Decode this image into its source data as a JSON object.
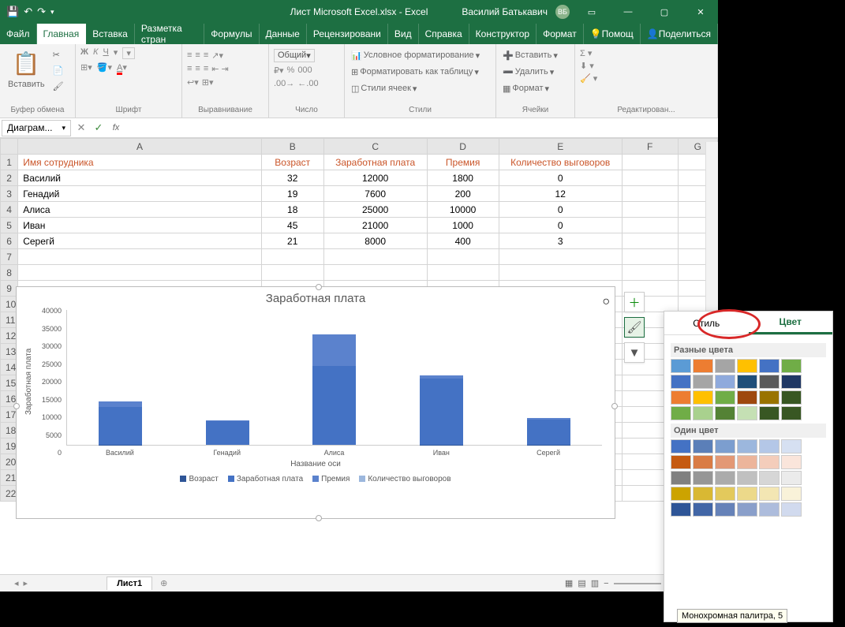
{
  "title": "Лист Microsoft Excel.xlsx  -  Excel",
  "user": "Василий Батькавич",
  "user_badge": "ВБ",
  "tabs": [
    "Файл",
    "Главная",
    "Вставка",
    "Разметка стран",
    "Формулы",
    "Данные",
    "Рецензировани",
    "Вид",
    "Справка",
    "Конструктор",
    "Формат"
  ],
  "help": "Помощ",
  "share": "Поделиться",
  "ribbon": {
    "clipboard": {
      "label": "Буфер обмена",
      "paste": "Вставить"
    },
    "font": {
      "label": "Шрифт"
    },
    "align": {
      "label": "Выравнивание"
    },
    "number": {
      "label": "Число",
      "format": "Общий"
    },
    "styles": {
      "label": "Стили",
      "cond": "Условное форматирование",
      "table": "Форматировать как таблицу",
      "cells": "Стили ячеек"
    },
    "cells_grp": {
      "label": "Ячейки",
      "insert": "Вставить",
      "delete": "Удалить",
      "format": "Формат"
    },
    "edit": {
      "label": "Редактирован..."
    }
  },
  "name_box": "Диаграм...",
  "headers": [
    "",
    "A",
    "B",
    "C",
    "D",
    "E",
    "F",
    "G"
  ],
  "column_headers": {
    "name": "Имя сотрудника",
    "age": "Возраст",
    "salary": "Заработная плата",
    "bonus": "Премия",
    "reprimands": "Количество выговоров"
  },
  "rows": [
    {
      "name": "Василий",
      "age": 32,
      "salary": 12000,
      "bonus": 1800,
      "rep": 0
    },
    {
      "name": "Генадий",
      "age": 19,
      "salary": 7600,
      "bonus": 200,
      "rep": 12
    },
    {
      "name": "Алиса",
      "age": 18,
      "salary": 25000,
      "bonus": 10000,
      "rep": 0
    },
    {
      "name": "Иван",
      "age": 45,
      "salary": 21000,
      "bonus": 1000,
      "rep": 0
    },
    {
      "name": "Серегй",
      "age": 21,
      "salary": 8000,
      "bonus": 400,
      "rep": 3
    }
  ],
  "chart_data": {
    "type": "bar",
    "title": "Заработная плата",
    "categories": [
      "Василий",
      "Генадий",
      "Алиса",
      "Иван",
      "Серегй"
    ],
    "series": [
      {
        "name": "Возраст",
        "values": [
          32,
          19,
          18,
          45,
          21
        ]
      },
      {
        "name": "Заработная плата",
        "values": [
          12000,
          7600,
          25000,
          21000,
          8000
        ]
      },
      {
        "name": "Премия",
        "values": [
          1800,
          200,
          10000,
          1000,
          400
        ]
      },
      {
        "name": "Количество выговоров",
        "values": [
          0,
          12,
          0,
          0,
          3
        ]
      }
    ],
    "ylim": [
      0,
      40000
    ],
    "ystep": 5000,
    "xlabel": "Название оси",
    "ylabel": "Заработная плата"
  },
  "sheet_tab": "Лист1",
  "color_panel": {
    "style": "Стиль",
    "color": "Цвет",
    "different": "Разные цвета",
    "single": "Один цвет",
    "tooltip": "Монохромная палитра, 5"
  },
  "palettes_diff": [
    [
      "#5b9bd5",
      "#ed7d31",
      "#a5a5a5",
      "#ffc000",
      "#4472c4",
      "#70ad47"
    ],
    [
      "#4472c4",
      "#a5a5a5",
      "#8faadc",
      "#1f4e79",
      "#595959",
      "#203864"
    ],
    [
      "#ed7d31",
      "#ffc000",
      "#70ad47",
      "#9e480e",
      "#997300",
      "#385723"
    ],
    [
      "#70ad47",
      "#a9d18e",
      "#548235",
      "#c5e0b4",
      "#385723",
      "#385723"
    ]
  ],
  "palettes_single": [
    [
      "#4472c4",
      "#5b7fb8",
      "#7c9ecf",
      "#9cb7dd",
      "#b4c7e7",
      "#d6e0f2"
    ],
    [
      "#c55a11",
      "#d97c45",
      "#e39875",
      "#ecb59b",
      "#f4cdbb",
      "#fae5db"
    ],
    [
      "#808080",
      "#969696",
      "#ababab",
      "#c0c0c0",
      "#d6d6d6",
      "#ebebeb"
    ],
    [
      "#cca300",
      "#d9b833",
      "#e3c95c",
      "#ecd98a",
      "#f3e6b3",
      "#f9f2d9"
    ],
    [
      "#2e5597",
      "#4266a6",
      "#6682b8",
      "#8a9fca",
      "#adbcdc",
      "#d1daee"
    ]
  ]
}
